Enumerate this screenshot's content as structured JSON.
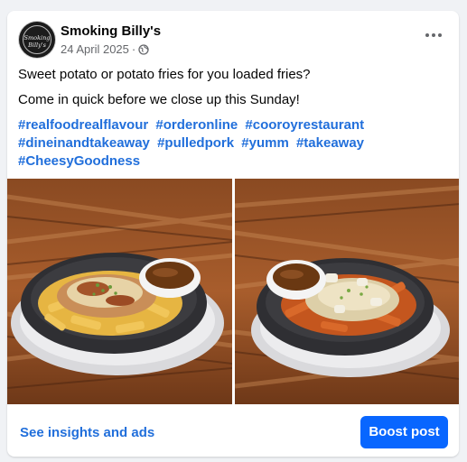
{
  "post": {
    "page_name": "Smoking Billy's",
    "avatar_text": "Smoking Billy's",
    "date": "24 April 2025",
    "separator": "·",
    "privacy_icon": "globe-icon",
    "more_icon": "more-options-icon",
    "lines": [
      "Sweet potato or potato fries for you loaded fries?",
      "Come in quick before we close up this Sunday!"
    ],
    "hashtags": [
      "#realfoodrealflavour",
      "#orderonline",
      "#cooroyrestaurant",
      "#dineinandtakeaway",
      "#pulledpork",
      "#yumm",
      "#takeaway",
      "#CheesyGoodness"
    ],
    "photos": [
      "loaded-potato-fries-photo",
      "loaded-sweet-potato-fries-photo"
    ]
  },
  "footer": {
    "insights_label": "See insights and ads",
    "boost_label": "Boost post"
  },
  "colors": {
    "link": "#216fdb",
    "boost_button": "#0866ff",
    "secondary_text": "#65676b"
  }
}
